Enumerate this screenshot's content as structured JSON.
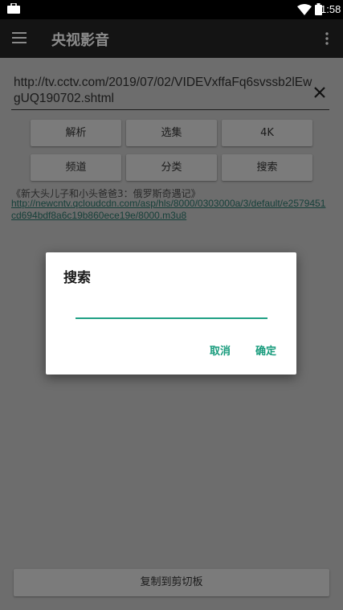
{
  "status_bar": {
    "time": "1:58"
  },
  "app_bar": {
    "title": "央视影音"
  },
  "url_field": {
    "value": "http://tv.cctv.com/2019/07/02/VIDEVxffaFq6svssb2lEwgUQ190702.shtml"
  },
  "buttons": {
    "parse": "解析",
    "episodes": "选集",
    "quality_4k": "4K",
    "channel": "频道",
    "category": "分类",
    "search": "搜索"
  },
  "result": {
    "title": "《新大头儿子和小头爸爸3：俄罗斯奇遇记》",
    "link": "http://newcntv.qcloudcdn.com/asp/hls/8000/0303000a/3/default/e2579451cd694bdf8a6c19b860ece19e/8000.m3u8"
  },
  "dialog": {
    "title": "搜索",
    "input_value": "",
    "cancel_label": "取消",
    "confirm_label": "确定",
    "accent_color": "#179b7c"
  },
  "footer": {
    "copy_label": "复制到剪切板"
  }
}
